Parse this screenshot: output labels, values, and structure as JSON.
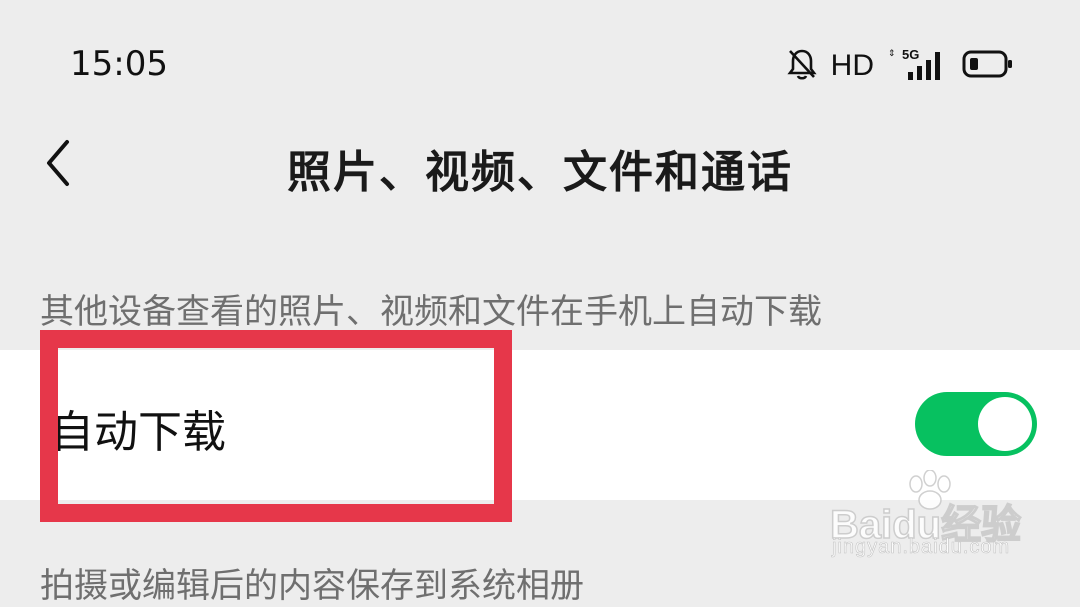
{
  "status_bar": {
    "time": "15:05",
    "hd": "HD",
    "network": "5G",
    "icons": [
      "bell-muted-icon",
      "signal-icon",
      "battery-icon"
    ]
  },
  "nav": {
    "back_icon": "chevron-left-icon",
    "title": "照片、视频、文件和通话"
  },
  "sections": [
    {
      "header": "其他设备查看的照片、视频和文件在手机上自动下载",
      "rows": [
        {
          "label": "自动下载",
          "toggle_on": true
        }
      ]
    },
    {
      "header": "拍摄或编辑后的内容保存到系统相册"
    }
  ],
  "colors": {
    "toggle_on": "#07c160",
    "highlight": "#e6374a",
    "background": "#ededed"
  },
  "watermark": {
    "logo": "Baidu经验",
    "url": "jingyan.baidu.com"
  }
}
